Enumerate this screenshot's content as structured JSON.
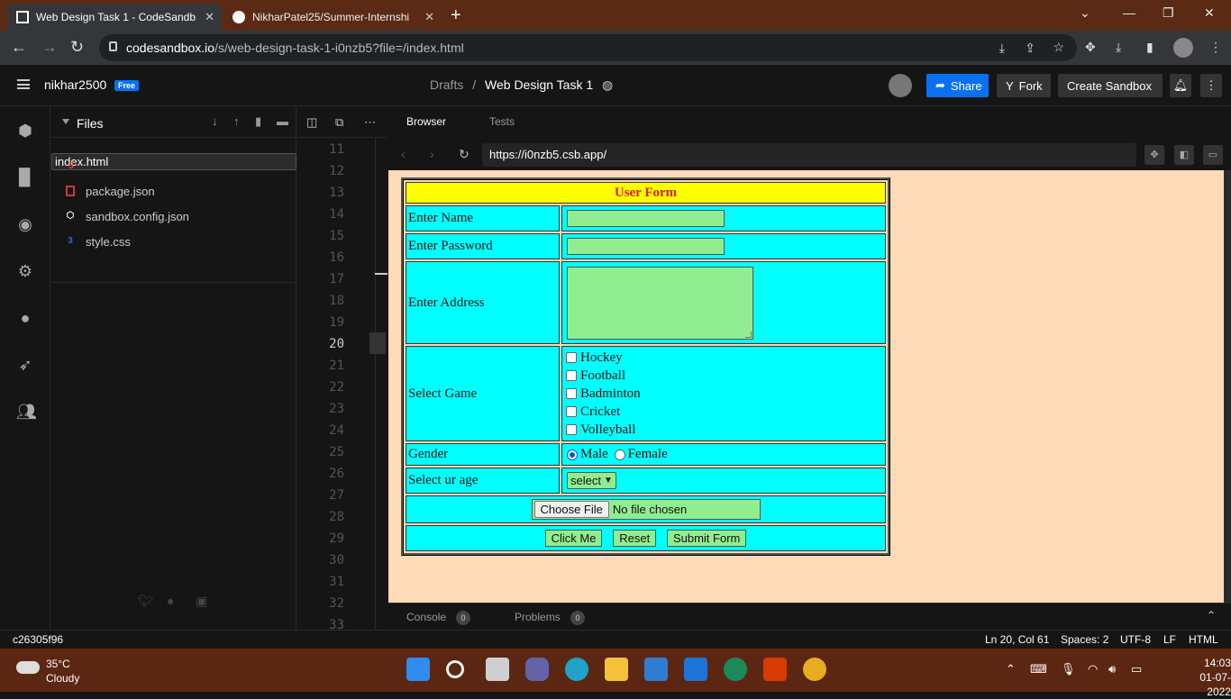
{
  "browser": {
    "tabs": [
      {
        "title": "Web Design Task 1 - CodeSandb",
        "active": true
      },
      {
        "title": "NikharPatel25/Summer-Internshi",
        "active": false
      }
    ],
    "url_host": "codesandbox.io",
    "url_path": "/s/web-design-task-1-i0nzb5?file=/index.html"
  },
  "header": {
    "username": "nikhar2500",
    "plan_badge": "Free",
    "breadcrumb_parent": "Drafts",
    "breadcrumb_sep": "/",
    "sandbox_title": "Web Design Task 1",
    "share_label": "Share",
    "fork_label": "Fork",
    "create_label": "Create Sandbox"
  },
  "sidebar": {
    "title": "Files",
    "files": [
      {
        "name": "index.html",
        "icon": "html5-icon",
        "color": "#e34c26"
      },
      {
        "name": "package.json",
        "icon": "npm-icon",
        "color": "#cb3837"
      },
      {
        "name": "sandbox.config.json",
        "icon": "cube-icon",
        "color": "#ffffff"
      },
      {
        "name": "style.css",
        "icon": "css3-icon",
        "color": "#2965f1"
      }
    ]
  },
  "editor": {
    "line_numbers": [
      "11",
      "12",
      "13",
      "14",
      "15",
      "16",
      "17",
      "18",
      "19",
      "20",
      "21",
      "22",
      "23",
      "24",
      "25",
      "26",
      "27",
      "28",
      "29",
      "30",
      "31",
      "32",
      "33"
    ],
    "current_line": "20"
  },
  "preview": {
    "tab_browser": "Browser",
    "tab_tests": "Tests",
    "url": "https://i0nzb5.csb.app/",
    "bottom_console": "Console",
    "console_count": "0",
    "bottom_problems": "Problems",
    "problems_count": "0"
  },
  "form": {
    "title": "User Form",
    "name_label": "Enter Name",
    "password_label": "Enter Password",
    "address_label": "Enter Address",
    "game_label": "Select Game",
    "games": [
      "Hockey",
      "Football",
      "Badminton",
      "Cricket",
      "Volleyball"
    ],
    "gender_label": "Gender",
    "gender_options": [
      "Male",
      "Female"
    ],
    "gender_selected": "Male",
    "age_label": "Select ur age",
    "age_value": "select",
    "file_button": "Choose File",
    "file_status": "No file chosen",
    "click_button": "Click Me",
    "reset_button": "Reset",
    "submit_button": "Submit Form"
  },
  "status": {
    "commit": "c26305f96",
    "position": "Ln 20, Col 61",
    "spaces": "Spaces: 2",
    "encoding": "UTF-8",
    "eol": "LF",
    "language": "HTML"
  },
  "taskbar": {
    "temperature": "35°C",
    "condition": "Cloudy",
    "time": "14:03",
    "date": "01-07-2022"
  },
  "colors": {
    "accent": "#0971f1",
    "form_cell": "#00ffff",
    "form_header": "#ffff00",
    "form_title": "#d91f1f",
    "form_inputs": "#90ee90",
    "preview_bg": "#ffdab9"
  }
}
